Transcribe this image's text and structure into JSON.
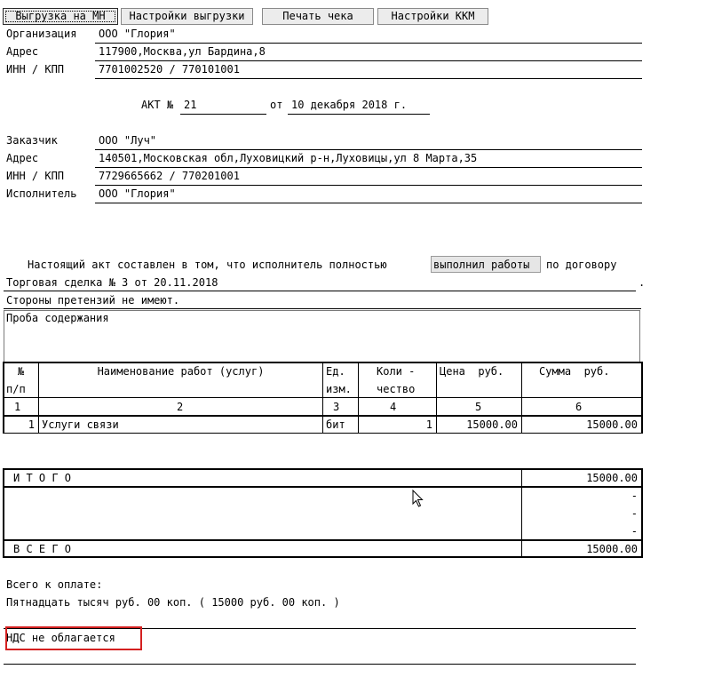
{
  "toolbar": {
    "export_mn": "Выгрузка на МН",
    "export_settings": "Настройки выгрузки",
    "print_receipt": "Печать чека",
    "kkm_settings": "Настройки ККМ"
  },
  "org": {
    "org_label": "Организация",
    "org_value": "ООО \"Глория\"",
    "addr_label": "Адрес",
    "addr_value": "117900,Москва,ул Бардина,8",
    "inn_label": "ИНН / КПП",
    "inn_value": "7701002520 / 770101001"
  },
  "act": {
    "title_label": "АКТ №",
    "number": "21",
    "from_label": "от",
    "date": "10 декабря 2018 г."
  },
  "customer": {
    "customer_label": "Заказчик",
    "customer_value": "ООО \"Луч\"",
    "addr_label": "Адрес",
    "addr_value": "140501,Московская обл,Луховицкий р-н,Луховицы,ул 8 Марта,35",
    "inn_label": "ИНН / КПП",
    "inn_value": "7729665662 / 770201001",
    "executor_label": "Исполнитель",
    "executor_value": "ООО \"Глория\""
  },
  "statement": {
    "prefix": "Настоящий акт составлен в том, что исполнитель полностью",
    "highlight": "выполнил работы",
    "suffix": "по договору",
    "contract": "Торговая сделка № 3 от 20.11.2018",
    "dot": ".",
    "no_claims": "Стороны претензий не имеют.",
    "memo": "Проба содержания"
  },
  "table": {
    "headers": {
      "num_1": "№",
      "num_2": "п/п",
      "name": "Наименование работ (услуг)",
      "unit_1": "Ед.",
      "unit_2": "изм.",
      "qty_1": "Коли -",
      "qty_2": "чество",
      "price": "Цена  руб.",
      "sum": "Сумма  руб."
    },
    "col_numbers": [
      "1",
      "2",
      "3",
      "4",
      "5",
      "6"
    ],
    "rows": [
      {
        "num": "1",
        "name": "Услуги связи",
        "unit": "бит",
        "qty": "1",
        "price": "15000.00",
        "sum": "15000.00"
      }
    ]
  },
  "totals": {
    "itogo_label": "И Т О Г О",
    "itogo_value": "15000.00",
    "dashes": [
      "-",
      "-",
      "-"
    ],
    "vsego_label": "В С Е Г О",
    "vsego_value": "15000.00"
  },
  "payment": {
    "label": "Всего к оплате:",
    "in_words": "Пятнадцать тысяч руб. 00 коп. ( 15000 руб. 00 коп. )",
    "vat": "НДС не облагается"
  },
  "colors": {
    "highlight_box": "#d42020",
    "button_bg": "#ececec"
  }
}
